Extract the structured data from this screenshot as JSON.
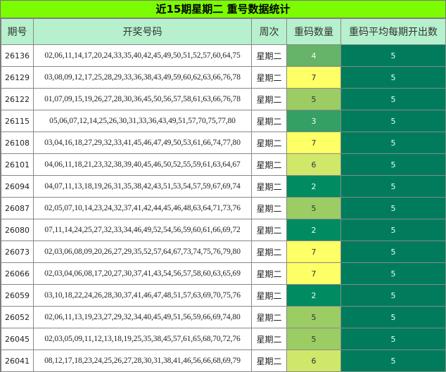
{
  "title": "近15期星期二 重号数据统计",
  "headers": {
    "issue": "期号",
    "numbers": "开奖号码",
    "weekday": "周次",
    "repeat_count": "重码数量",
    "avg": "重码平均每期开出数"
  },
  "colors": {
    "title_bg": "#7cfc00",
    "header_bg": "#b7f0cd",
    "avg_bg": "#007c5c",
    "repeat_7": "#ffff66",
    "repeat_6": "#cfe86a",
    "repeat_5": "#9ccc64",
    "repeat_4": "#66b36a",
    "repeat_3": "#34a064",
    "repeat_2": "#008b60"
  },
  "rows": [
    {
      "issue": "26136",
      "numbers": "02,06,11,14,17,20,24,33,35,40,42,45,49,50,51,52,57,60,64,75",
      "weekday": "星期二",
      "repeat": "4",
      "avg": "5"
    },
    {
      "issue": "26129",
      "numbers": "03,08,09,12,17,25,28,29,33,36,38,43,49,59,60,62,63,66,76,78",
      "weekday": "星期二",
      "repeat": "7",
      "avg": "5"
    },
    {
      "issue": "26122",
      "numbers": "01,07,09,15,19,26,27,28,30,36,45,50,56,57,58,61,63,66,76,78",
      "weekday": "星期二",
      "repeat": "5",
      "avg": "5"
    },
    {
      "issue": "26115",
      "numbers": "05,06,07,12,14,25,26,30,31,33,36,43,49,51,57,70,75,77,80",
      "weekday": "星期二",
      "repeat": "3",
      "avg": "5"
    },
    {
      "issue": "26108",
      "numbers": "03,04,16,18,27,29,32,33,41,45,46,47,49,50,53,61,66,74,77,80",
      "weekday": "星期二",
      "repeat": "7",
      "avg": "5"
    },
    {
      "issue": "26101",
      "numbers": "04,06,11,18,21,23,32,38,39,40,45,46,50,52,55,59,61,63,64,67",
      "weekday": "星期二",
      "repeat": "6",
      "avg": "5"
    },
    {
      "issue": "26094",
      "numbers": "04,07,11,13,18,19,26,31,35,38,42,43,51,53,54,57,59,67,69,74",
      "weekday": "星期二",
      "repeat": "2",
      "avg": "5"
    },
    {
      "issue": "26087",
      "numbers": "02,05,07,10,14,23,24,32,37,41,42,44,45,46,48,63,64,71,73,76",
      "weekday": "星期二",
      "repeat": "5",
      "avg": "5"
    },
    {
      "issue": "26080",
      "numbers": "07,11,14,24,25,27,32,33,34,46,49,52,54,56,59,60,61,66,69,72",
      "weekday": "星期二",
      "repeat": "2",
      "avg": "5"
    },
    {
      "issue": "26073",
      "numbers": "02,03,06,08,09,20,26,27,29,35,52,57,64,67,73,74,75,76,79,80",
      "weekday": "星期二",
      "repeat": "7",
      "avg": "5"
    },
    {
      "issue": "26066",
      "numbers": "02,03,04,06,08,17,20,27,30,37,41,43,54,56,57,58,60,63,65,69",
      "weekday": "星期二",
      "repeat": "7",
      "avg": "5"
    },
    {
      "issue": "26059",
      "numbers": "03,10,18,22,24,26,28,30,37,41,46,47,48,51,57,63,69,70,75,76",
      "weekday": "星期二",
      "repeat": "2",
      "avg": "5"
    },
    {
      "issue": "26052",
      "numbers": "02,06,11,13,19,23,27,29,32,34,40,45,49,51,56,59,66,69,74,80",
      "weekday": "星期二",
      "repeat": "5",
      "avg": "5"
    },
    {
      "issue": "26045",
      "numbers": "02,03,05,09,11,12,13,18,19,25,35,38,45,57,61,65,68,70,72,76",
      "weekday": "星期二",
      "repeat": "5",
      "avg": "5"
    },
    {
      "issue": "26041",
      "numbers": "08,12,17,18,23,24,25,26,27,28,30,31,38,41,46,56,66,68,69,79",
      "weekday": "星期二",
      "repeat": "6",
      "avg": "5"
    }
  ]
}
